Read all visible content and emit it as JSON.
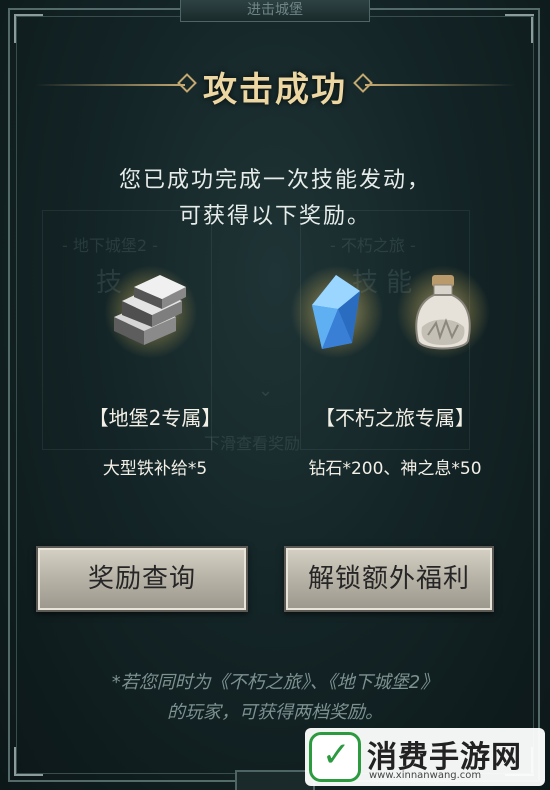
{
  "header": {
    "tab_text": "进击城堡",
    "title": "攻击成功"
  },
  "message": {
    "line1": "您已成功完成一次技能发动，",
    "line2": "可获得以下奖励。"
  },
  "background_text": {
    "left_card": "- 地下城堡2 -",
    "right_card": "- 不朽之旅 -",
    "left_skill": "技",
    "right_skill": "技 能",
    "scroll_hint": "下滑查看奖励"
  },
  "rewards": [
    {
      "group": "【地堡2专属】",
      "items_text": "大型铁补给*5",
      "icons": [
        "iron-ingot-icon"
      ]
    },
    {
      "group": "【不朽之旅专属】",
      "items_text": "钻石*200、神之息*50",
      "icons": [
        "diamond-icon",
        "bottle-icon"
      ]
    }
  ],
  "buttons": {
    "query": "奖励查询",
    "unlock": "解锁额外福利"
  },
  "footnote": {
    "line1": "*若您同时为《不朽之旅》、《地下城堡2》",
    "line2": "的玩家，可获得两档奖励。"
  },
  "watermark": {
    "logo_text": "✓",
    "title": "消费手游网",
    "url": "www.xinnanwang.com"
  },
  "colors": {
    "title": "#ecd6a2",
    "panel_bg": "#142527",
    "button_face": "#c6c1b5",
    "note_text": "#7d9191"
  }
}
